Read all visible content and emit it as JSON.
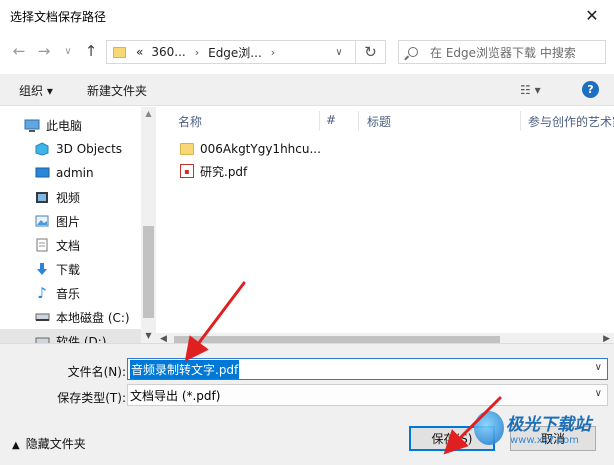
{
  "window": {
    "title": "选择文档保存路径",
    "close_glyph": "✕"
  },
  "nav": {
    "back": "←",
    "forward": "→",
    "recent": "∨",
    "up": "↑",
    "breadcrumb": [
      "«",
      "360...",
      "Edge浏..."
    ],
    "refresh": "↻",
    "search_placeholder": "在 Edge浏览器下载 中搜索"
  },
  "toolbar": {
    "organize": "组织 ▾",
    "new_folder": "新建文件夹",
    "view_icon": "☷ ▾",
    "help": "?"
  },
  "sidebar": {
    "items": [
      {
        "label": "此电脑",
        "icon": "computer-icon"
      },
      {
        "label": "3D Objects",
        "icon": "cube-icon"
      },
      {
        "label": "admin",
        "icon": "desktop-icon"
      },
      {
        "label": "视频",
        "icon": "video-icon"
      },
      {
        "label": "图片",
        "icon": "picture-icon"
      },
      {
        "label": "文档",
        "icon": "document-icon"
      },
      {
        "label": "下载",
        "icon": "download-icon"
      },
      {
        "label": "音乐",
        "icon": "music-icon"
      },
      {
        "label": "本地磁盘 (C:)",
        "icon": "drive-icon"
      },
      {
        "label": "软件 (D:)",
        "icon": "drive-icon"
      }
    ]
  },
  "columns": [
    "名称",
    "#",
    "标题",
    "参与创作的艺术家"
  ],
  "files": [
    {
      "name": "006AkgtYgy1hhcu...",
      "type": "folder"
    },
    {
      "name": "研究.pdf",
      "type": "pdf"
    }
  ],
  "form": {
    "filename_label": "文件名(N):",
    "filename_value": "音频录制转文字.pdf",
    "filetype_label": "保存类型(T):",
    "filetype_value": "文档导出 (*.pdf)"
  },
  "footer": {
    "hide_folders": "隐藏文件夹",
    "save": "保存(S)",
    "cancel": "取消"
  },
  "watermark": {
    "line1": "极光下载站",
    "line2": "www.xz7.com"
  },
  "colors": {
    "accent": "#0078d7",
    "arrow": "#e02020"
  }
}
